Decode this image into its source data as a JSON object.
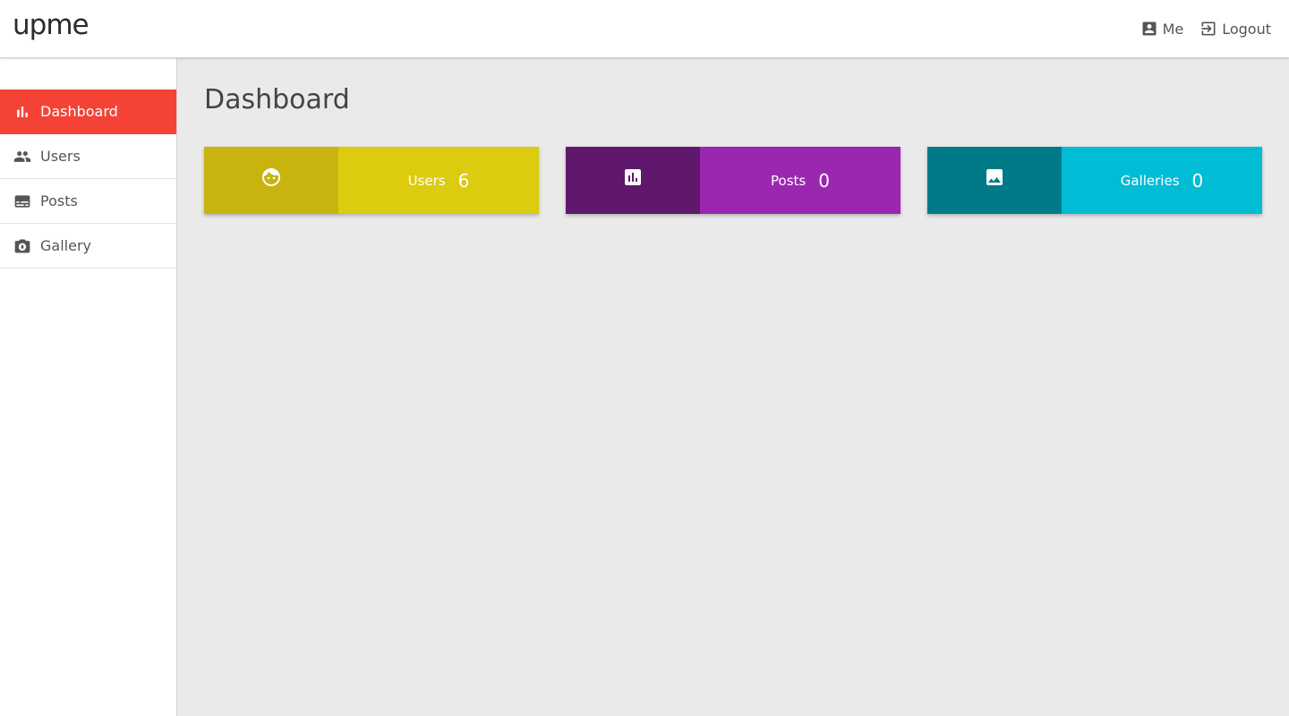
{
  "header": {
    "logo": "upme",
    "me_label": "Me",
    "logout_label": "Logout"
  },
  "sidebar": {
    "items": [
      {
        "label": "Dashboard",
        "icon": "bar-chart-icon",
        "active": true
      },
      {
        "label": "Users",
        "icon": "people-icon",
        "active": false
      },
      {
        "label": "Posts",
        "icon": "subtitles-icon",
        "active": false
      },
      {
        "label": "Gallery",
        "icon": "camera-icon",
        "active": false
      }
    ]
  },
  "main": {
    "title": "Dashboard",
    "cards": [
      {
        "label": "Users",
        "value": "6",
        "icon": "face-icon",
        "icon_bg": "#c9b30e",
        "bg": "#ddcb10"
      },
      {
        "label": "Posts",
        "value": "0",
        "icon": "poll-icon",
        "icon_bg": "#5f186c",
        "bg": "#9b27b0"
      },
      {
        "label": "Galleries",
        "value": "0",
        "icon": "image-icon",
        "icon_bg": "#017a87",
        "bg": "#00bcd5"
      }
    ]
  },
  "colors": {
    "accent": "#f44336",
    "background": "#eaeaea"
  }
}
